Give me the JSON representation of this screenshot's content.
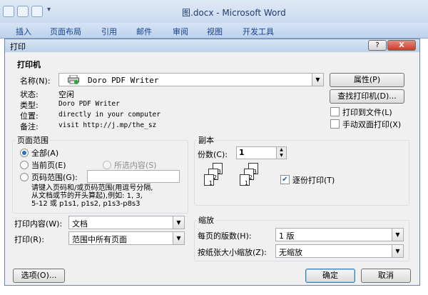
{
  "app": {
    "window_title": "图.docx - Microsoft Word",
    "ribbon_tabs": [
      "插入",
      "页面布局",
      "引用",
      "邮件",
      "审阅",
      "视图",
      "开发工具"
    ]
  },
  "dialog": {
    "title": "打印",
    "help_label": "?",
    "close_label": "X",
    "printer": {
      "group_title": "打印机",
      "name_label": "名称(N):",
      "name_value": "Doro PDF Writer",
      "properties_button": "属性(P)",
      "find_printer_button": "查找打印机(D)...",
      "status_label": "状态:",
      "status_value": "空闲",
      "type_label": "类型:",
      "type_value": "Doro PDF Writer",
      "where_label": "位置:",
      "where_value": "directly in your computer",
      "comment_label": "备注:",
      "comment_value": "visit http://j.mp/the_sz",
      "print_to_file_label": "打印到文件(L)",
      "manual_duplex_label": "手动双面打印(X)"
    },
    "page_range": {
      "group_title": "页面范围",
      "all_label": "全部(A)",
      "current_page_label": "当前页(E)",
      "selection_label": "所选内容(S)",
      "pages_label": "页码范围(G):",
      "pages_value": "",
      "hint_line1": "请键入页码和/或页码范围(用逗号分隔,",
      "hint_line2": "从文档或节的开头算起),例如: 1, 3,",
      "hint_line3": "5-12 或 p1s1, p1s2, p1s3-p8s3"
    },
    "copies": {
      "group_title": "副本",
      "copies_label": "份数(C):",
      "copies_value": "1",
      "collate_label": "逐份打印(T)",
      "collate_checked": true
    },
    "print_what_label": "打印内容(W):",
    "print_what_value": "文档",
    "print_label": "打印(R):",
    "print_value": "范围中所有页面",
    "zoom": {
      "group_title": "缩放",
      "pages_per_sheet_label": "每页的版数(H):",
      "pages_per_sheet_value": "1 版",
      "scale_label": "按纸张大小缩放(Z):",
      "scale_value": "无缩放"
    },
    "options_button": "选项(O)...",
    "ok_button": "确定",
    "cancel_button": "取消"
  }
}
